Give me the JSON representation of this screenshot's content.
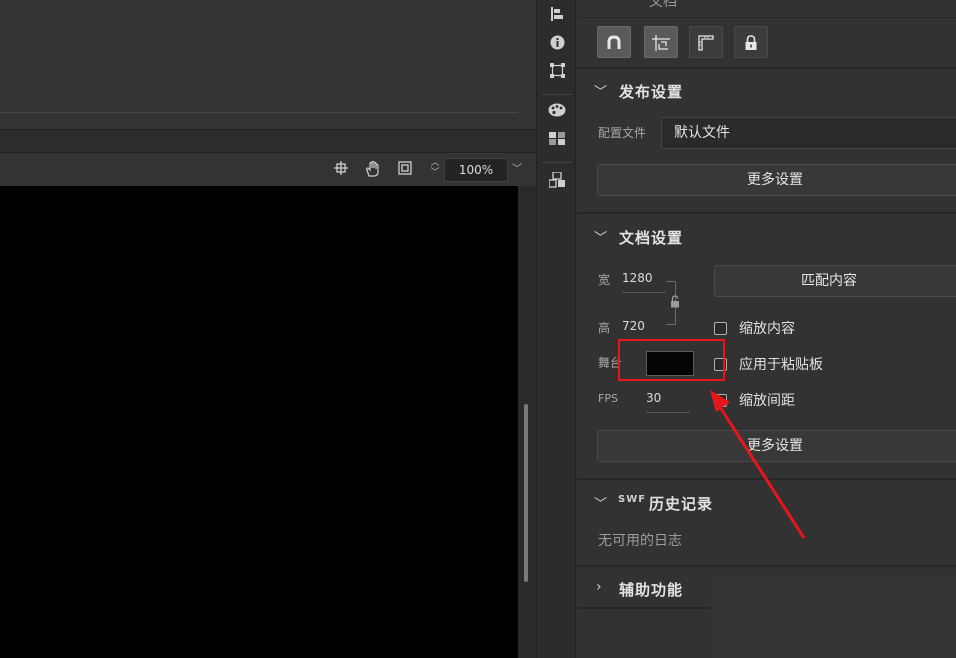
{
  "stage_toolbar": {
    "icons": [
      "crosshair-icon",
      "hand-icon",
      "frame-icon"
    ],
    "zoom_value": "100%"
  },
  "icon_column": {
    "icons": [
      "align-icon",
      "info-icon",
      "transform-icon",
      "palette-icon",
      "swatches-icon",
      "library-icon"
    ]
  },
  "panel": {
    "partial_header": "文档",
    "tool_buttons": [
      {
        "icon": "magnet-icon",
        "active": true
      },
      {
        "icon": "snap-guide-icon",
        "active": true
      },
      {
        "icon": "ruler-icon",
        "active": false
      },
      {
        "icon": "lock-icon",
        "active": false
      }
    ],
    "publish": {
      "title": "发布设置",
      "profile_label": "配置文件",
      "profile_value": "默认文件",
      "more_button": "更多设置"
    },
    "document": {
      "title": "文档设置",
      "width_label": "宽",
      "width_value": "1280",
      "height_label": "高",
      "height_value": "720",
      "stage_label": "舞台",
      "stage_color": "#050505",
      "fps_label": "FPS",
      "fps_value": "30",
      "match_button": "匹配内容",
      "checkboxes": [
        {
          "label": "缩放内容",
          "checked": false
        },
        {
          "label": "应用于粘贴板",
          "checked": false
        },
        {
          "label": "缩放间距",
          "checked": false
        }
      ],
      "more_button": "更多设置"
    },
    "swf_history": {
      "tag": "SWF",
      "title": "历史记录",
      "empty_text": "无可用的日志"
    },
    "accessibility": {
      "title": "辅助功能"
    }
  },
  "colors": {
    "highlight": "#e8161b",
    "panel_bg": "#323232",
    "canvas_bg": "#000000"
  }
}
